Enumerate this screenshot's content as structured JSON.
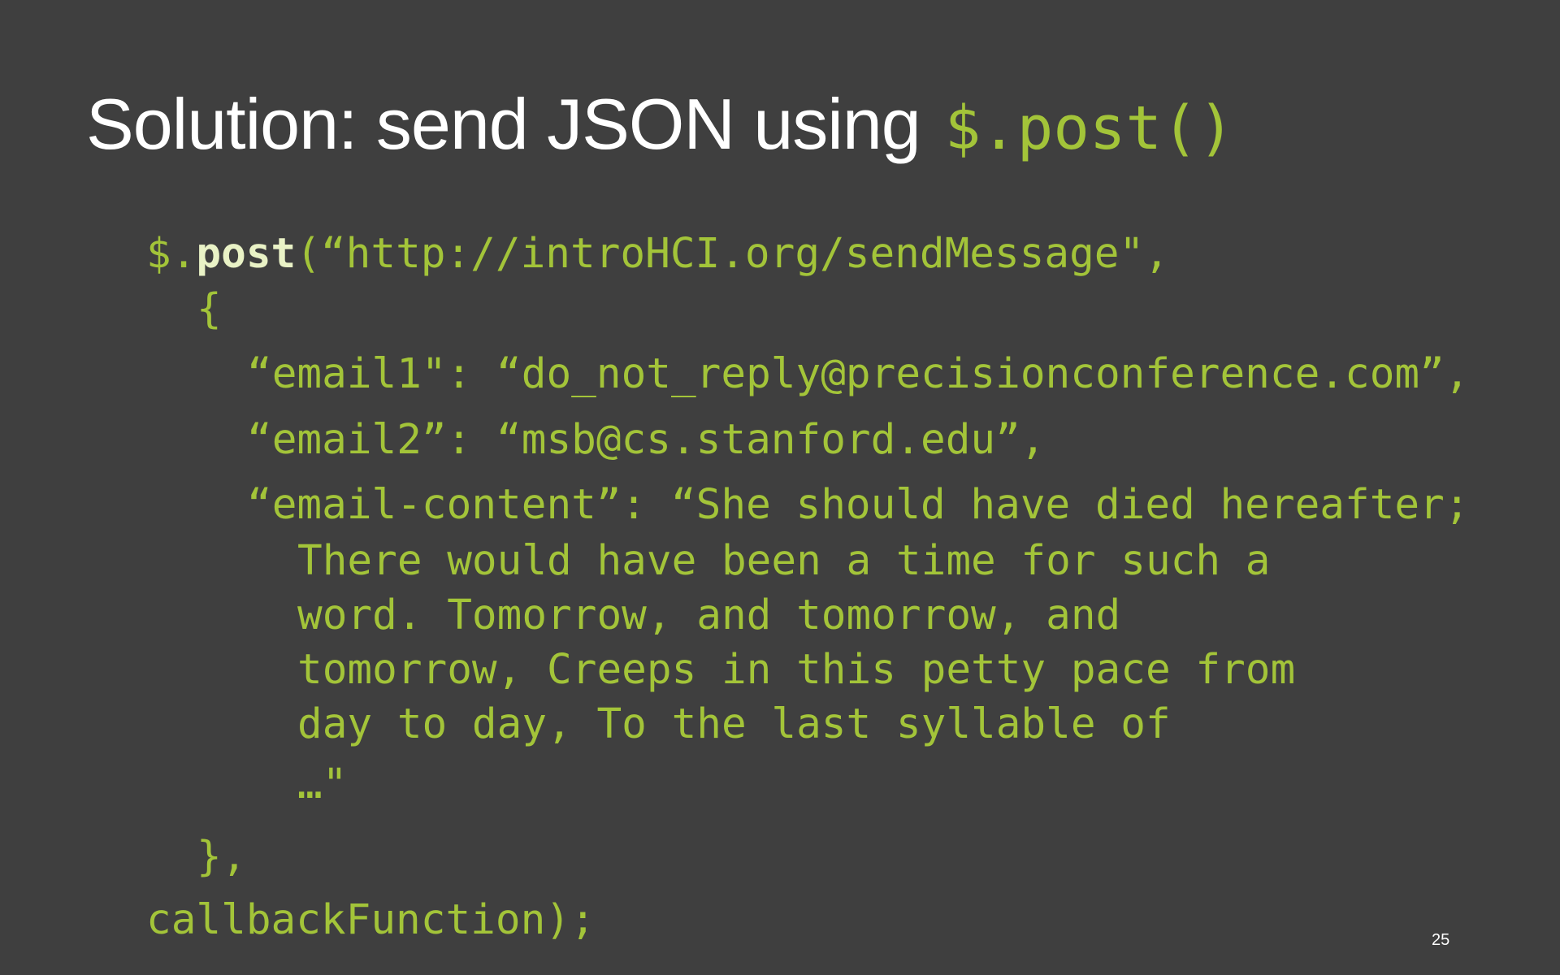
{
  "slide": {
    "title": "Solution: send JSON using",
    "title_code": "$.post()",
    "code": {
      "line1_prefix": "$.",
      "line1_method": "post",
      "line1_rest": "(“http://introHCI.org/sendMessage\",",
      "line2": "{",
      "line3": "“email1\": “do_not_reply@precisionconference.com”,",
      "line4": "“email2”: “msb@cs.stanford.edu”,",
      "line5": "“email-content”: “She should have died hereafter;",
      "line6": "There would have been a time for such a",
      "line7": "word. Tomorrow, and tomorrow, and",
      "line8": "tomorrow, Creeps in this petty pace from",
      "line9": "day to day, To the last syllable of",
      "line10": "…\"",
      "line11": "},",
      "line12": "callbackFunction);"
    },
    "page_number": "25"
  },
  "colors": {
    "background": "#3f3f3f",
    "title": "#ffffff",
    "code": "#a3c439",
    "method_highlight": "#e9f2c6"
  }
}
